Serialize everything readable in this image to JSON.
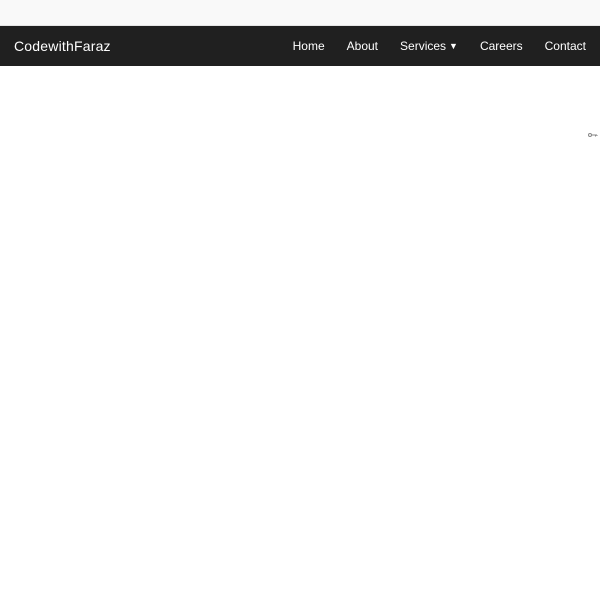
{
  "navbar": {
    "brand": "CodewithFaraz",
    "items": [
      {
        "label": "Home",
        "hasDropdown": false
      },
      {
        "label": "About",
        "hasDropdown": false
      },
      {
        "label": "Services",
        "hasDropdown": true
      },
      {
        "label": "Careers",
        "hasDropdown": false
      },
      {
        "label": "Contact",
        "hasDropdown": false
      }
    ]
  }
}
